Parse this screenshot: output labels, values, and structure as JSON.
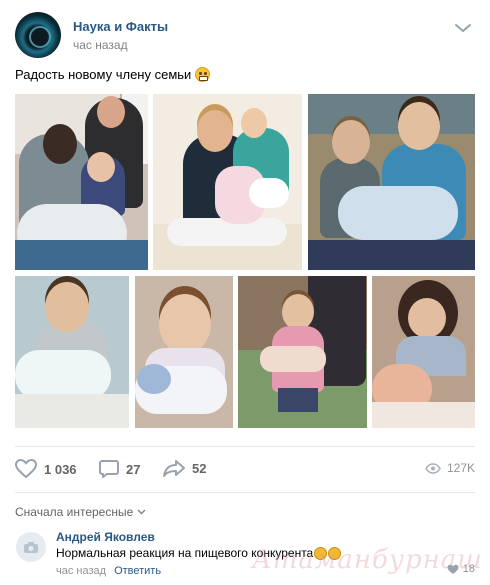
{
  "post": {
    "author": "Наука и Факты",
    "time": "час назад",
    "text": "Радость новому члену семьи"
  },
  "photos": [
    {
      "name": "photo-1-family-couch",
      "bg": "#cfc3b8"
    },
    {
      "name": "photo-2-mother-daughters",
      "bg": "#f2ece2"
    },
    {
      "name": "photo-3-brothers-baby",
      "bg": "#6b7f86"
    },
    {
      "name": "photo-4-boy-baby",
      "bg": "#b8c9cf"
    },
    {
      "name": "photo-5-girl-baby",
      "bg": "#c9b7a8"
    },
    {
      "name": "photo-6-girl-outdoor",
      "bg": "#7d9a6a"
    },
    {
      "name": "photo-7-vintage-kids",
      "bg": "#b9a08c"
    }
  ],
  "actions": {
    "likes": "1 036",
    "comments": "27",
    "shares": "52",
    "views": "127K"
  },
  "comments": {
    "sort_label": "Сначала интересные",
    "items": [
      {
        "author": "Андрей Яковлев",
        "text": "Нормальная реакция на пищевого конкурента",
        "time": "час назад",
        "reply_label": "Ответить",
        "likes": "18"
      }
    ]
  },
  "watermark": "Атаманбурнаш для.ru",
  "colors": {
    "link": "#2a5885",
    "secondary_text": "#828282",
    "icon_gray": "#99a2ad",
    "divider": "#e7e8ec"
  }
}
